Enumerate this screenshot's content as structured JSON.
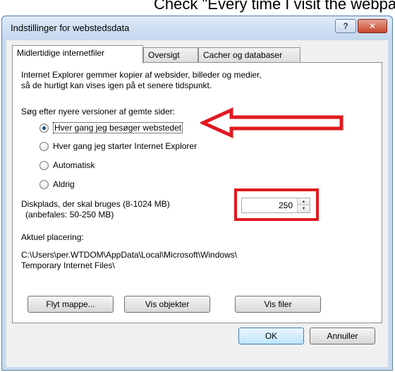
{
  "caption_text": "Check \"Every time I visit the webpage\" and",
  "window": {
    "title": "Indstillinger for webstedsdata",
    "help_glyph": "?",
    "close_glyph": "✕"
  },
  "tabs": [
    {
      "label": "Midlertidige internetfiler",
      "active": true
    },
    {
      "label": "Oversigt",
      "active": false
    },
    {
      "label": "Cacher og databaser",
      "active": false
    }
  ],
  "panel": {
    "description_line1": "Internet Explorer gemmer kopier af websider, billeder og medier,",
    "description_line2": "så de hurtigt kan vises igen på et senere tidspunkt.",
    "check_heading": "Søg efter nyere versioner af gemte sider:",
    "options": [
      {
        "label": "Hver gang jeg besøger webstedet",
        "checked": true
      },
      {
        "label": "Hver gang jeg starter Internet Explorer",
        "checked": false
      },
      {
        "label": "Automatisk",
        "checked": false
      },
      {
        "label": "Aldrig",
        "checked": false
      }
    ],
    "disk_label_line1": "Diskplads, der skal bruges (8-1024 MB)",
    "disk_label_line2": "(anbefales: 50-250 MB)",
    "disk_value": "250",
    "location_heading": "Aktuel placering:",
    "location_line1": "C:\\Users\\per.WTDOM\\AppData\\Local\\Microsoft\\Windows\\",
    "location_line2": "Temporary Internet Files\\",
    "buttons": {
      "move": "Flyt mappe...",
      "objects": "Vis objekter",
      "files": "Vis filer"
    }
  },
  "footer": {
    "ok": "OK",
    "cancel": "Annuller"
  },
  "colors": {
    "annotation_red": "#e0191f",
    "title_bar": "#c4d7ee",
    "close_button": "#c7452d"
  }
}
